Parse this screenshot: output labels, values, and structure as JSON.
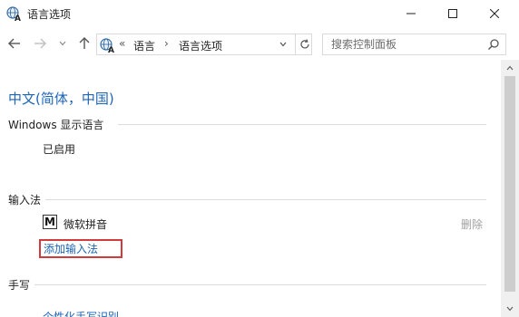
{
  "window": {
    "title": "语言选项",
    "icons": {
      "app": "language-globe-icon",
      "minimize": "minimize-icon",
      "maximize": "maximize-icon",
      "close": "close-icon"
    }
  },
  "nav": {
    "icons": {
      "back": "arrow-left-icon",
      "forward": "arrow-right-icon",
      "recent": "chevron-down-icon",
      "up": "arrow-up-icon",
      "refresh": "refresh-icon"
    },
    "address": {
      "overflow": "«",
      "segments": [
        "语言",
        "语言选项"
      ],
      "separator": "›"
    },
    "search": {
      "placeholder": "搜索控制面板",
      "value": ""
    }
  },
  "main": {
    "language_title": "中文(简体，中国)",
    "display_section": {
      "heading": "Windows 显示语言",
      "status": "已启用"
    },
    "ime_section": {
      "heading": "输入法",
      "items": [
        {
          "badge": "M",
          "label": "微软拼音",
          "action": "删除"
        }
      ],
      "add_link": "添加输入法"
    },
    "handwriting_section": {
      "heading": "手写",
      "link": "个性化手写识别"
    }
  },
  "colors": {
    "link": "#1e64b4",
    "highlight_box": "#d23b3b",
    "disabled_text": "#a0a0a0",
    "divider": "#dcdcdc"
  }
}
